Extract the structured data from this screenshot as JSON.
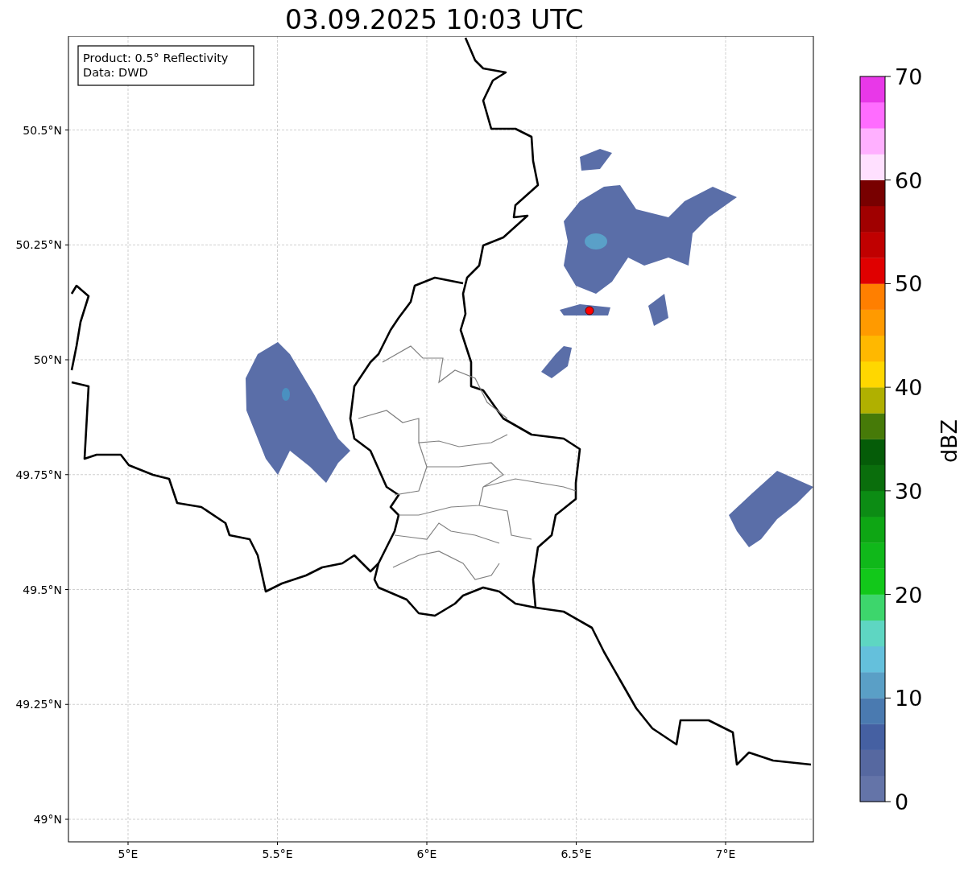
{
  "title": "03.09.2025 10:03 UTC",
  "legend": [
    "Product: 0.5° Reflectivity",
    "Data: DWD"
  ],
  "map": {
    "x_ticks": [
      "5°E",
      "5.5°E",
      "6°E",
      "6.5°E",
      "7°E"
    ],
    "y_ticks": [
      "50.5°N",
      "50.25°N",
      "50°N",
      "49.75°N",
      "49.5°N",
      "49.25°N",
      "49°N"
    ]
  },
  "colorbar": {
    "label": "dBZ",
    "ticks": [
      "70",
      "60",
      "50",
      "40",
      "30",
      "20",
      "10",
      "0"
    ],
    "bands": [
      {
        "color": "#6474a8"
      },
      {
        "color": "#5668a0"
      },
      {
        "color": "#4560a2"
      },
      {
        "color": "#4a7ab0"
      },
      {
        "color": "#5a9fc6"
      },
      {
        "color": "#64c0dc"
      },
      {
        "color": "#5ed6c2"
      },
      {
        "color": "#3dd66c"
      },
      {
        "color": "#12c81a"
      },
      {
        "color": "#10b81a"
      },
      {
        "color": "#0ea614"
      },
      {
        "color": "#0c8c14"
      },
      {
        "color": "#0a6e0c"
      },
      {
        "color": "#055c08"
      },
      {
        "color": "#467a08"
      },
      {
        "color": "#b0b000"
      },
      {
        "color": "#ffd700"
      },
      {
        "color": "#ffb800"
      },
      {
        "color": "#ff9a00"
      },
      {
        "color": "#ff7f00"
      },
      {
        "color": "#e00000"
      },
      {
        "color": "#c00000"
      },
      {
        "color": "#a00000"
      },
      {
        "color": "#780000"
      },
      {
        "color": "#ffe0ff"
      },
      {
        "color": "#ffb0ff"
      },
      {
        "color": "#ff6cff"
      },
      {
        "color": "#e838e8"
      }
    ]
  }
}
